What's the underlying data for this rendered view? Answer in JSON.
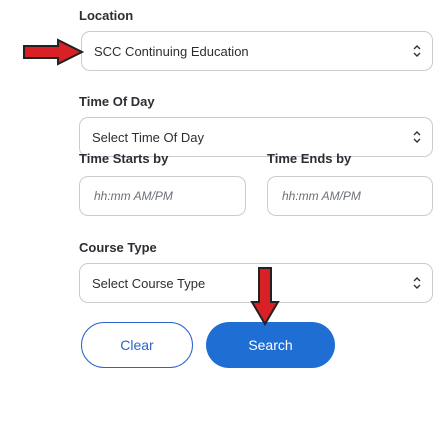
{
  "form": {
    "location": {
      "label": "Location",
      "value": "SCC Continuing Education"
    },
    "time_of_day": {
      "label": "Time Of Day",
      "value": "Select Time Of Day"
    },
    "time_starts": {
      "label": "Time Starts by",
      "placeholder": "hh:mm AM/PM"
    },
    "time_ends": {
      "label": "Time Ends by",
      "placeholder": "hh:mm AM/PM"
    },
    "course_type": {
      "label": "Course Type",
      "value": "Select Course Type"
    }
  },
  "buttons": {
    "clear": "Clear",
    "search": "Search"
  },
  "colors": {
    "primary": "#1f6ed4",
    "annotation": "#d92026"
  },
  "icons": {
    "select": "chevron-up-down-icon",
    "annotation": "red-arrow-icon"
  }
}
